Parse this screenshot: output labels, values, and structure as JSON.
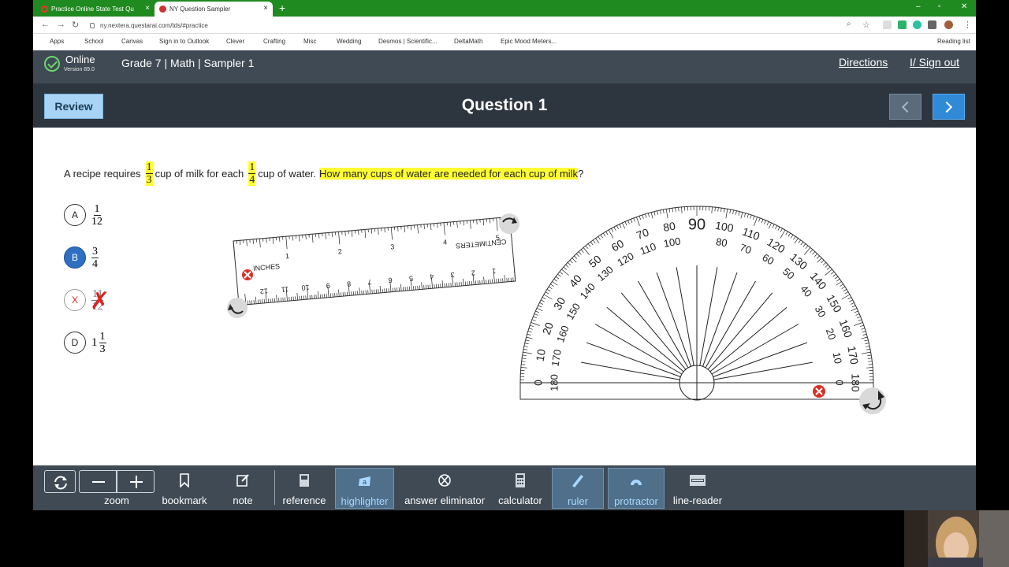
{
  "browser": {
    "tabs": [
      {
        "label": "Practice Online State Test Qu"
      },
      {
        "label": "NY Question Sampler"
      }
    ],
    "new_tab": "+",
    "url": "ny.nextera.questarai.com/tds/#practice",
    "window_buttons": {
      "minimize": "–",
      "maximize": "▫",
      "close": "✕"
    },
    "bookmarks": [
      {
        "label": "Apps",
        "color": "#4a7bd0"
      },
      {
        "label": "School",
        "color": "#f2c84b"
      },
      {
        "label": "Canvas",
        "color": "#444444"
      },
      {
        "label": "Sign in to Outlook",
        "color": "#1d6fd1"
      },
      {
        "label": "Clever",
        "color": "#4353ff"
      },
      {
        "label": "Crafting",
        "color": "#f2c84b"
      },
      {
        "label": "Misc",
        "color": "#f2c84b"
      },
      {
        "label": "Wedding",
        "color": "#f2c84b"
      },
      {
        "label": "Desmos | Scientific...",
        "color": "#2a9a3a"
      },
      {
        "label": "DeltaMath",
        "color": "#222222"
      },
      {
        "label": "Epic Mood Meters...",
        "color": "#f0a020"
      }
    ],
    "reading_list": "Reading list"
  },
  "header": {
    "status": "Online",
    "version": "Version 89.0",
    "test_title": "Grade 7 | Math | Sampler 1",
    "directions": "Directions",
    "sign_out": "I/ Sign out"
  },
  "nav": {
    "review": "Review",
    "question_title": "Question 1"
  },
  "question": {
    "text_a": "A recipe requires",
    "frac1": {
      "num": "1",
      "den": "3"
    },
    "text_b": "cup of milk for each",
    "frac2": {
      "num": "1",
      "den": "4"
    },
    "text_c": "cup of water.",
    "highlighted": "How many cups of water are needed for each cup of milk",
    "end": "?"
  },
  "choices": [
    {
      "letter": "A",
      "num": "1",
      "den": "12",
      "state": "none"
    },
    {
      "letter": "B",
      "num": "3",
      "den": "4",
      "state": "selected"
    },
    {
      "letter": "X",
      "num": "11",
      "den": "12",
      "state": "eliminated"
    },
    {
      "letter": "D",
      "whole": "1",
      "num": "1",
      "den": "3",
      "state": "none"
    }
  ],
  "ruler": {
    "inches_label": "INCHES",
    "cm_label": "CENTIMETERS",
    "inch_numbers": [
      "1",
      "2",
      "3",
      "4",
      "5"
    ],
    "cm_numbers": [
      "12",
      "11",
      "10",
      "9",
      "8",
      "7",
      "6",
      "5",
      "4",
      "3",
      "2",
      "1"
    ]
  },
  "protractor": {
    "outer_labels": [
      "0",
      "10",
      "20",
      "30",
      "40",
      "50",
      "60",
      "70",
      "80",
      "90",
      "100",
      "110",
      "120",
      "130",
      "140",
      "150",
      "160",
      "170",
      "180"
    ],
    "inner_labels": [
      "180",
      "170",
      "160",
      "150",
      "140",
      "130",
      "120",
      "110",
      "100",
      "90",
      "80",
      "70",
      "60",
      "50",
      "40",
      "30",
      "20",
      "10",
      "0"
    ]
  },
  "toolbar": {
    "zoom": "zoom",
    "bookmark": "bookmark",
    "note": "note",
    "reference": "reference",
    "highlighter": "highlighter",
    "answer_eliminator": "answer eliminator",
    "calculator": "calculator",
    "ruler": "ruler",
    "protractor": "protractor",
    "line_reader": "line-reader"
  },
  "colors": {
    "header_bg": "#3f4a54",
    "nav_bg": "#2d363f",
    "highlight": "#ffff33",
    "selected_choice": "#2f6fc2",
    "eliminate_red": "#dd2222"
  }
}
